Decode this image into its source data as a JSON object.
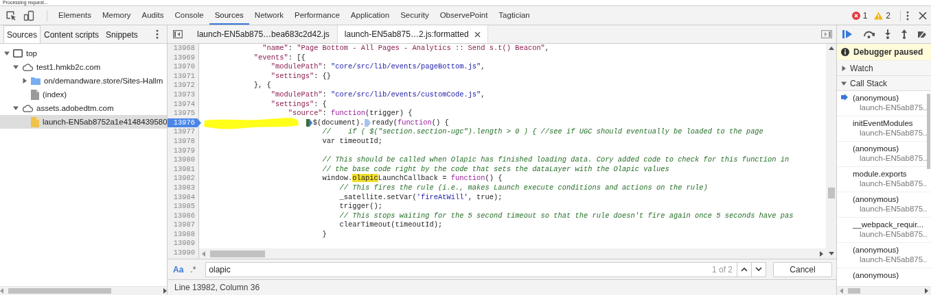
{
  "status_message": "Processing request...",
  "main_tabs": [
    {
      "label": "Elements",
      "selected": false
    },
    {
      "label": "Memory",
      "selected": false
    },
    {
      "label": "Audits",
      "selected": false
    },
    {
      "label": "Console",
      "selected": false
    },
    {
      "label": "Sources",
      "selected": true
    },
    {
      "label": "Network",
      "selected": false
    },
    {
      "label": "Performance",
      "selected": false
    },
    {
      "label": "Application",
      "selected": false
    },
    {
      "label": "Security",
      "selected": false
    },
    {
      "label": "ObservePoint",
      "selected": false
    },
    {
      "label": "Tagtician",
      "selected": false
    }
  ],
  "console_counts": {
    "errors": "1",
    "warnings": "2"
  },
  "navigator": {
    "tabs": [
      {
        "label": "Sources",
        "selected": true
      },
      {
        "label": "Content scripts",
        "selected": false
      },
      {
        "label": "Snippets",
        "selected": false
      }
    ],
    "tree": [
      {
        "label": "top",
        "kind": "frame",
        "expanded": true,
        "selected": false,
        "children": [
          {
            "label": "test1.hmkb2c.com",
            "kind": "domain",
            "expanded": true,
            "selected": false,
            "children": [
              {
                "label": "on/demandware.store/Sites-Hallm",
                "kind": "folder",
                "expanded": false,
                "selected": false
              },
              {
                "label": "(index)",
                "kind": "document",
                "selected": false
              }
            ]
          },
          {
            "label": "assets.adobedtm.com",
            "kind": "domain",
            "expanded": true,
            "selected": false,
            "children": [
              {
                "label": "launch-EN5ab8752a1e4148439580",
                "kind": "script",
                "selected": true
              }
            ]
          }
        ]
      }
    ]
  },
  "editor": {
    "tabs": [
      {
        "label": "launch-EN5ab875…bea683c2d42.js",
        "selected": false
      },
      {
        "label": "launch-EN5ab875…2.js:formatted",
        "selected": true
      }
    ],
    "lines": [
      {
        "number": "13968",
        "breakpoint": false,
        "tokens": [
          {
            "kind": "key",
            "text": "              \"name\""
          },
          {
            "kind": "plain",
            "text": ": "
          },
          {
            "kind": "key",
            "text": "\"Page Bottom - All Pages - Analytics :: Send s.t() Beacon\""
          },
          {
            "kind": "plain",
            "text": ","
          }
        ]
      },
      {
        "number": "13969",
        "breakpoint": false,
        "tokens": [
          {
            "kind": "key",
            "text": "            \"events\""
          },
          {
            "kind": "plain",
            "text": ": [{"
          }
        ]
      },
      {
        "number": "13970",
        "breakpoint": false,
        "tokens": [
          {
            "kind": "key",
            "text": "                \"modulePath\""
          },
          {
            "kind": "plain",
            "text": ": "
          },
          {
            "kind": "str",
            "text": "\"core/src/lib/events/pageBottom.js\""
          },
          {
            "kind": "plain",
            "text": ","
          }
        ]
      },
      {
        "number": "13971",
        "breakpoint": false,
        "tokens": [
          {
            "kind": "key",
            "text": "                \"settings\""
          },
          {
            "kind": "plain",
            "text": ": {}"
          }
        ]
      },
      {
        "number": "13972",
        "breakpoint": false,
        "tokens": [
          {
            "kind": "plain",
            "text": "            }, {"
          }
        ]
      },
      {
        "number": "13973",
        "breakpoint": false,
        "tokens": [
          {
            "kind": "key",
            "text": "                \"modulePath\""
          },
          {
            "kind": "plain",
            "text": ": "
          },
          {
            "kind": "str",
            "text": "\"core/src/lib/events/customCode.js\""
          },
          {
            "kind": "plain",
            "text": ","
          }
        ]
      },
      {
        "number": "13974",
        "breakpoint": false,
        "tokens": [
          {
            "kind": "key",
            "text": "                \"settings\""
          },
          {
            "kind": "plain",
            "text": ": {"
          }
        ]
      },
      {
        "number": "13975",
        "breakpoint": false,
        "tokens": [
          {
            "kind": "key",
            "text": "                    \"source\""
          },
          {
            "kind": "plain",
            "text": ": "
          },
          {
            "kind": "kw",
            "text": "function"
          },
          {
            "kind": "plain",
            "text": "(trigger) {"
          }
        ]
      },
      {
        "number": "13976",
        "breakpoint": true,
        "tokens": [
          {
            "kind": "plain",
            "text": "                        $(document).",
            "marker_active": true
          },
          {
            "kind": "plain",
            "text": "ready(",
            "marker_active": false
          },
          {
            "kind": "kw",
            "text": "function"
          },
          {
            "kind": "plain",
            "text": "() {"
          }
        ]
      },
      {
        "number": "13977",
        "breakpoint": false,
        "tokens": [
          {
            "kind": "com",
            "text": "                            //    if ( $(\"section.section-ugc\").length > 0 ) { //see if UGC should eventually be loaded to the page"
          }
        ]
      },
      {
        "number": "13978",
        "breakpoint": false,
        "tokens": [
          {
            "kind": "plain",
            "text": "                            var timeoutId;"
          }
        ]
      },
      {
        "number": "13979",
        "breakpoint": false
      },
      {
        "number": "13980",
        "breakpoint": false,
        "tokens": [
          {
            "kind": "com",
            "text": "                            // This should be called when Olapic has finished loading data. Cory added code to check for this function in"
          }
        ]
      },
      {
        "number": "13981",
        "breakpoint": false,
        "tokens": [
          {
            "kind": "com",
            "text": "                            // the base code right by the code that sets the dataLayer with the Olapic values"
          }
        ]
      },
      {
        "number": "13982",
        "breakpoint": false,
        "tokens": [
          {
            "kind": "plain",
            "text": "                            window."
          },
          {
            "kind": "match",
            "text": "olapic"
          },
          {
            "kind": "plain",
            "text": "LaunchCallback = "
          },
          {
            "kind": "kw",
            "text": "function"
          },
          {
            "kind": "plain",
            "text": "() {"
          }
        ]
      },
      {
        "number": "13983",
        "breakpoint": false,
        "tokens": [
          {
            "kind": "com",
            "text": "                                // This fires the rule (i.e., makes Launch execute conditions and actions on the rule)"
          }
        ]
      },
      {
        "number": "13984",
        "breakpoint": false,
        "tokens": [
          {
            "kind": "plain",
            "text": "                                _satellite.setVar("
          },
          {
            "kind": "str",
            "text": "'fireAtWill'"
          },
          {
            "kind": "plain",
            "text": ", true);"
          }
        ]
      },
      {
        "number": "13985",
        "breakpoint": false,
        "tokens": [
          {
            "kind": "plain",
            "text": "                                trigger();"
          }
        ]
      },
      {
        "number": "13986",
        "breakpoint": false,
        "tokens": [
          {
            "kind": "com",
            "text": "                                // This stops waiting for the 5 second timeout so that the rule doesn't fire again once 5 seconds have pas"
          }
        ]
      },
      {
        "number": "13987",
        "breakpoint": false,
        "tokens": [
          {
            "kind": "plain",
            "text": "                                clearTimeout(timeoutId);"
          }
        ]
      },
      {
        "number": "13988",
        "breakpoint": false,
        "tokens": [
          {
            "kind": "plain",
            "text": "                            }"
          }
        ]
      },
      {
        "number": "13989",
        "breakpoint": false
      },
      {
        "number": "13990",
        "breakpoint": false
      }
    ]
  },
  "search": {
    "match_case_label": "Aa",
    "match_case": true,
    "regex_label": ".*",
    "regex": false,
    "value": "olapic",
    "count": "1 of 2",
    "cancel": "Cancel"
  },
  "status_bar": "Line 13982, Column 36",
  "debugger": {
    "banner": "Debugger paused",
    "sections": [
      {
        "label": "Watch",
        "expanded": false
      },
      {
        "label": "Call Stack",
        "expanded": true
      }
    ],
    "frames": [
      {
        "name": "(anonymous)",
        "location": "launch-EN5ab875..",
        "selected": true
      },
      {
        "name": "initEventModules",
        "location": "launch-EN5ab875..",
        "selected": false
      },
      {
        "name": "(anonymous)",
        "location": "launch-EN5ab875..",
        "selected": false
      },
      {
        "name": "module.exports",
        "location": "launch-EN5ab875..",
        "selected": false
      },
      {
        "name": "(anonymous)",
        "location": "launch-EN5ab875..",
        "selected": false
      },
      {
        "name": "__webpack_requir...",
        "location": "launch-EN5ab875..",
        "selected": false
      },
      {
        "name": "(anonymous)",
        "location": "launch-EN5ab875..",
        "selected": false
      },
      {
        "name": "(anonymous)",
        "selected": false
      }
    ]
  }
}
